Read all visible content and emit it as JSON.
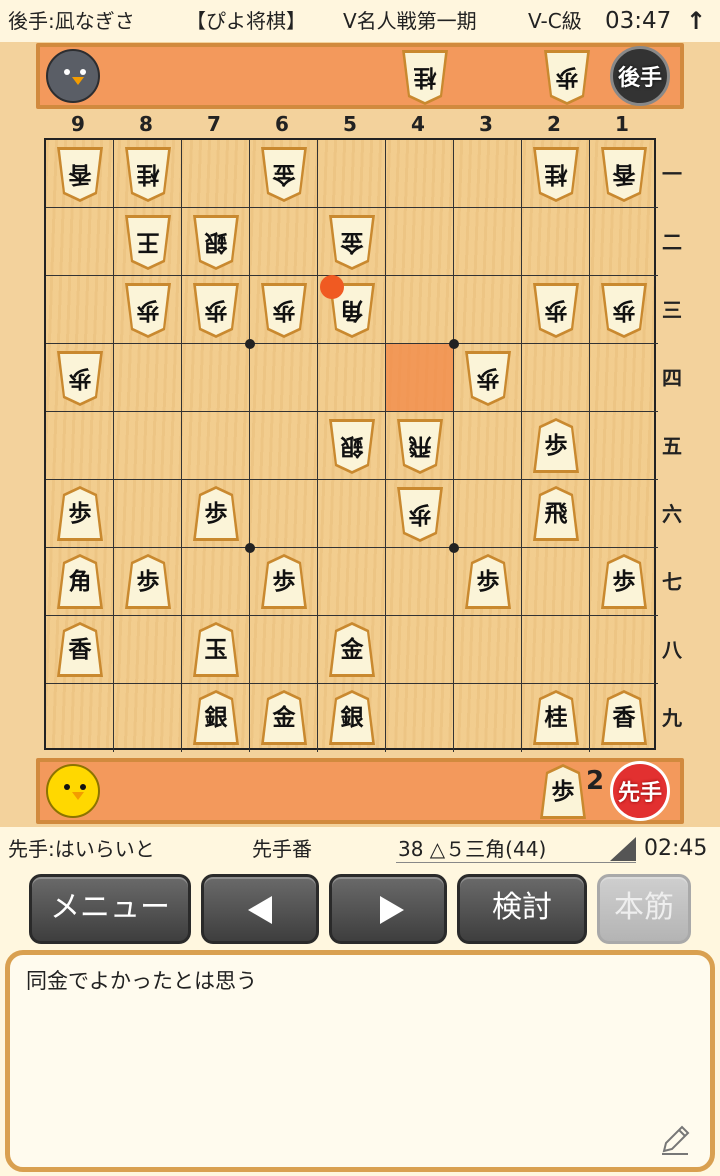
{
  "top_bar": {
    "player": "後手:凪なぎさ",
    "app": "【ぴよ将棋】",
    "event": "V名人戦第一期",
    "rank": "V-C級",
    "clock": "03:47",
    "arrow": "↑"
  },
  "gote_stand": {
    "label": "後手",
    "pieces": [
      "桂",
      "歩"
    ]
  },
  "sente_stand": {
    "label": "先手",
    "piece": "歩",
    "count": "2"
  },
  "files": [
    "9",
    "8",
    "7",
    "6",
    "5",
    "4",
    "3",
    "2",
    "1"
  ],
  "ranks": [
    "一",
    "二",
    "三",
    "四",
    "五",
    "六",
    "七",
    "八",
    "九"
  ],
  "board_pieces": [
    {
      "file": 9,
      "rank": 1,
      "char": "香",
      "side": "gote"
    },
    {
      "file": 8,
      "rank": 1,
      "char": "桂",
      "side": "gote"
    },
    {
      "file": 6,
      "rank": 1,
      "char": "金",
      "side": "gote"
    },
    {
      "file": 2,
      "rank": 1,
      "char": "桂",
      "side": "gote"
    },
    {
      "file": 1,
      "rank": 1,
      "char": "香",
      "side": "gote"
    },
    {
      "file": 8,
      "rank": 2,
      "char": "王",
      "side": "gote"
    },
    {
      "file": 7,
      "rank": 2,
      "char": "銀",
      "side": "gote"
    },
    {
      "file": 5,
      "rank": 2,
      "char": "金",
      "side": "gote"
    },
    {
      "file": 8,
      "rank": 3,
      "char": "歩",
      "side": "gote"
    },
    {
      "file": 7,
      "rank": 3,
      "char": "歩",
      "side": "gote"
    },
    {
      "file": 6,
      "rank": 3,
      "char": "歩",
      "side": "gote"
    },
    {
      "file": 5,
      "rank": 3,
      "char": "角",
      "side": "gote"
    },
    {
      "file": 2,
      "rank": 3,
      "char": "歩",
      "side": "gote"
    },
    {
      "file": 1,
      "rank": 3,
      "char": "歩",
      "side": "gote"
    },
    {
      "file": 9,
      "rank": 4,
      "char": "歩",
      "side": "gote"
    },
    {
      "file": 3,
      "rank": 4,
      "char": "歩",
      "side": "gote"
    },
    {
      "file": 5,
      "rank": 5,
      "char": "銀",
      "side": "gote"
    },
    {
      "file": 4,
      "rank": 5,
      "char": "飛",
      "side": "gote"
    },
    {
      "file": 2,
      "rank": 5,
      "char": "歩",
      "side": "sente"
    },
    {
      "file": 9,
      "rank": 6,
      "char": "歩",
      "side": "sente"
    },
    {
      "file": 7,
      "rank": 6,
      "char": "歩",
      "side": "sente"
    },
    {
      "file": 4,
      "rank": 6,
      "char": "歩",
      "side": "gote"
    },
    {
      "file": 2,
      "rank": 6,
      "char": "飛",
      "side": "sente"
    },
    {
      "file": 9,
      "rank": 7,
      "char": "角",
      "side": "sente"
    },
    {
      "file": 8,
      "rank": 7,
      "char": "歩",
      "side": "sente"
    },
    {
      "file": 6,
      "rank": 7,
      "char": "歩",
      "side": "sente"
    },
    {
      "file": 3,
      "rank": 7,
      "char": "歩",
      "side": "sente"
    },
    {
      "file": 1,
      "rank": 7,
      "char": "歩",
      "side": "sente"
    },
    {
      "file": 9,
      "rank": 8,
      "char": "香",
      "side": "sente"
    },
    {
      "file": 7,
      "rank": 8,
      "char": "玉",
      "side": "sente"
    },
    {
      "file": 5,
      "rank": 8,
      "char": "金",
      "side": "sente"
    },
    {
      "file": 7,
      "rank": 9,
      "char": "銀",
      "side": "sente"
    },
    {
      "file": 6,
      "rank": 9,
      "char": "金",
      "side": "sente"
    },
    {
      "file": 5,
      "rank": 9,
      "char": "銀",
      "side": "sente"
    },
    {
      "file": 2,
      "rank": 9,
      "char": "桂",
      "side": "sente"
    },
    {
      "file": 1,
      "rank": 9,
      "char": "香",
      "side": "sente"
    }
  ],
  "highlight_square": {
    "file": 4,
    "rank": 4
  },
  "last_move_marker": {
    "file": 5,
    "rank": 3
  },
  "info": {
    "sente_player": "先手:はいらいと",
    "turn": "先手番",
    "move": "38 △５三角(44)",
    "clock": "02:45"
  },
  "buttons": {
    "menu": "メニュー",
    "prev": "◀",
    "next": "▶",
    "review": "検討",
    "mainline": "本筋"
  },
  "comment": "同金でよかったとは思う",
  "colors": {
    "stand": "#f3995c",
    "board": "#f2cb8a",
    "highlight": "#f28746",
    "marker": "#f05a22"
  }
}
